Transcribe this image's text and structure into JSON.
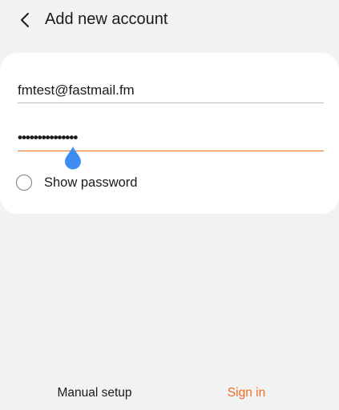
{
  "header": {
    "back_icon": "chevron-left-icon",
    "title": "Add new account"
  },
  "form": {
    "email_value": "fmtest@fastmail.fm",
    "password_value": "•••••••••••••••",
    "show_password_label": "Show password",
    "show_password_checked": false
  },
  "actions": {
    "manual_setup_label": "Manual setup",
    "sign_in_label": "Sign in"
  },
  "colors": {
    "accent": "#f26d21",
    "cursor_handle": "#3d8ef0",
    "background": "#f2f2f2",
    "card": "#ffffff"
  }
}
